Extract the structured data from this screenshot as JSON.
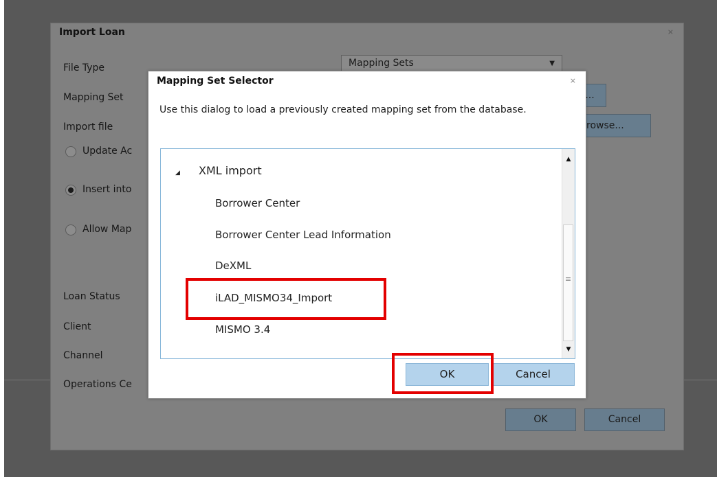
{
  "outer_dialog": {
    "title": "Import Loan",
    "labels": {
      "file_type": "File Type",
      "mapping_set": "Mapping Set",
      "import_file": "Import file",
      "loan_status": "Loan Status",
      "client": "Client",
      "channel": "Channel",
      "operations_center": "Operations Ce"
    },
    "file_type_value": "Mapping Sets",
    "mapping_set_button": "...",
    "browse_button": "rowse...",
    "radios": [
      {
        "label": "Update Ac",
        "checked": false
      },
      {
        "label": "Insert into",
        "checked": true
      },
      {
        "label": "Allow Map",
        "checked": false
      }
    ],
    "ok_label": "OK",
    "cancel_label": "Cancel"
  },
  "inner_dialog": {
    "title": "Mapping Set Selector",
    "description": "Use this dialog to load a previously created mapping set from the database.",
    "tree_group": "XML import",
    "items": [
      "Borrower Center",
      "Borrower Center Lead Information",
      "DeXML",
      "iLAD_MISMO34_Import",
      "MISMO 3.4"
    ],
    "selected_item": "iLAD_MISMO34_Import",
    "ok_label": "OK",
    "cancel_label": "Cancel"
  },
  "colors": {
    "highlight": "#e30000",
    "button_blue": "#b4d3ec",
    "list_border": "#86b6d9"
  }
}
